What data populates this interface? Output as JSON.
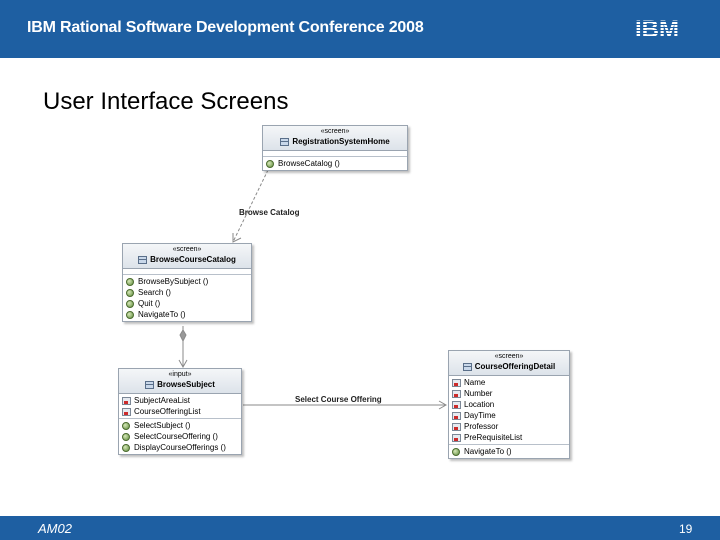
{
  "header": {
    "title": "IBM Rational Software Development Conference 2008",
    "logo": "IBM"
  },
  "slide": {
    "title": "User Interface Screens"
  },
  "diagram": {
    "home": {
      "stereotype": "«screen»",
      "name": "RegistrationSystemHome",
      "operations": [
        "BrowseCatalog ()"
      ]
    },
    "catalog": {
      "stereotype": "«screen»",
      "name": "BrowseCourseCatalog",
      "operations": [
        "BrowseBySubject ()",
        "Search ()",
        "Quit ()",
        "NavigateTo ()"
      ]
    },
    "subject": {
      "stereotype": "«input»",
      "name": "BrowseSubject",
      "attributes": [
        "SubjectAreaList",
        "CourseOfferingList"
      ],
      "operations": [
        "SelectSubject ()",
        "SelectCourseOffering ()",
        "DisplayCourseOfferings ()"
      ]
    },
    "detail": {
      "stereotype": "«screen»",
      "name": "CourseOfferingDetail",
      "attributes": [
        "Name",
        "Number",
        "Location",
        "DayTime",
        "Professor",
        "PreRequisiteList"
      ],
      "operations": [
        "NavigateTo ()"
      ]
    },
    "edges": {
      "browse": "Browse Catalog",
      "select": "Select Course Offering"
    }
  },
  "footer": {
    "left": "AM02",
    "page": "19"
  },
  "colors": {
    "band": "#1e5fa2"
  }
}
